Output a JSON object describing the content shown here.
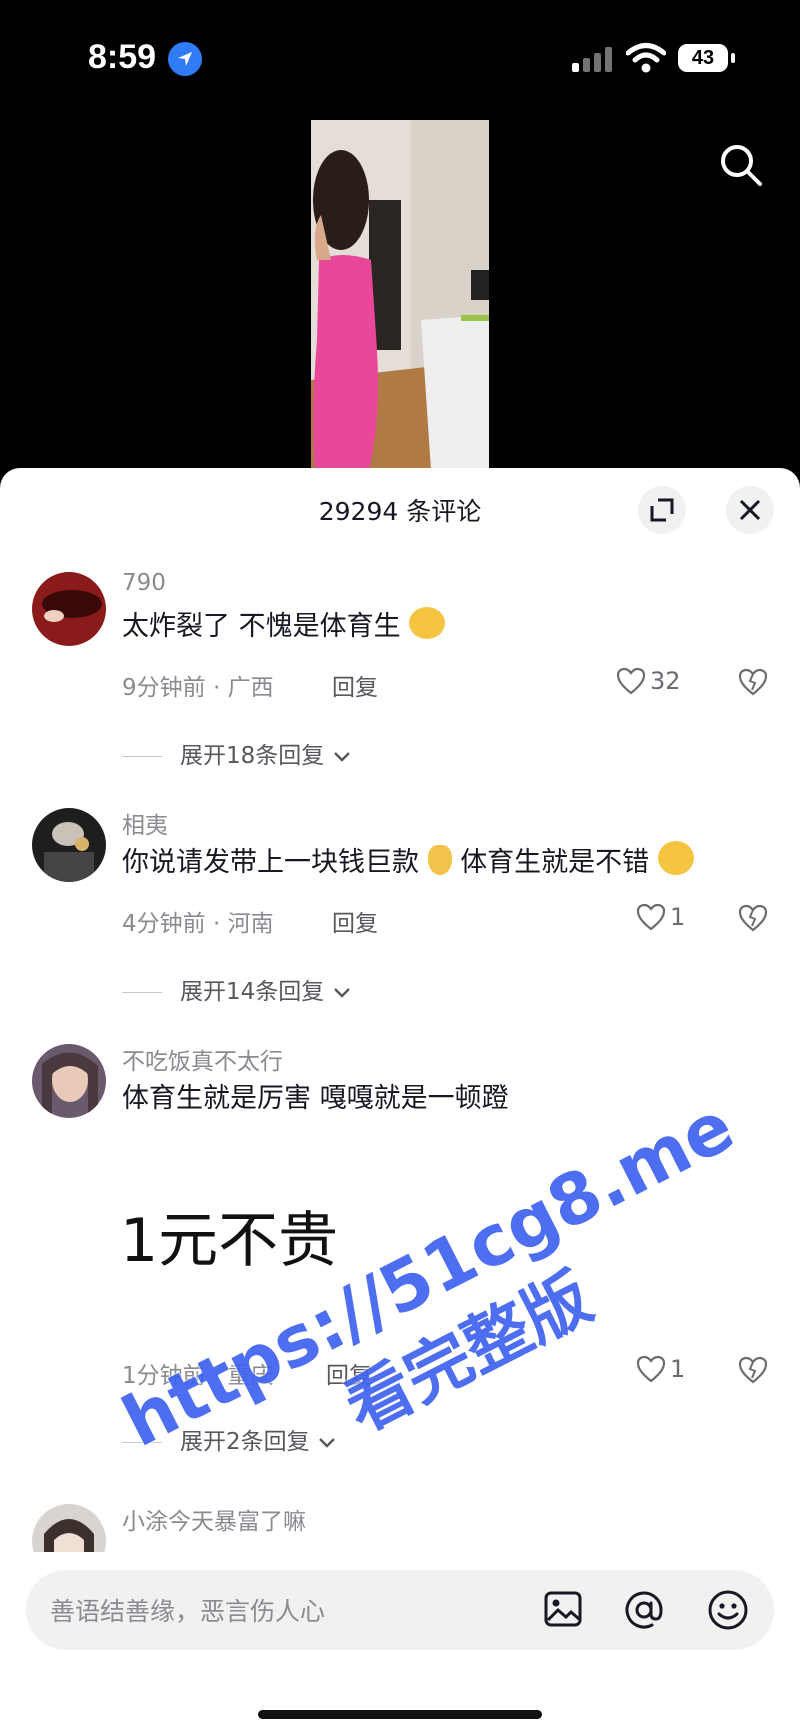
{
  "status_bar": {
    "time": "8:59",
    "battery": "43"
  },
  "comments_panel": {
    "title": "29294 条评论",
    "comments": [
      {
        "username": "790",
        "text": "太炸裂了 不愧是体育生",
        "time_location": "9分钟前 · 广西",
        "reply_label": "回复",
        "likes": "32",
        "expand_label": "展开18条回复"
      },
      {
        "username": "相夷",
        "text_part1": "你说请发带上一块钱巨款",
        "text_part2": "体育生就是不错",
        "time_location": "4分钟前 · 河南",
        "reply_label": "回复",
        "likes": "1",
        "expand_label": "展开14条回复"
      },
      {
        "username": "不吃饭真不太行",
        "text": "体育生就是厉害 嘎嘎就是一顿蹬",
        "image_text": "1元不贵",
        "time_location": "1分钟前 · 重庆",
        "reply_label": "回复",
        "likes": "1",
        "expand_label": "展开2条回复"
      },
      {
        "username": "小涂今天暴富了嘛"
      }
    ]
  },
  "input": {
    "placeholder": "善语结善缘，恶言伤人心"
  },
  "watermark": {
    "line1": "https://51cg8.me",
    "line2": "看完整版"
  },
  "colors": {
    "accent_watermark": "#3f62f0",
    "dress": "#e8479a",
    "muted_text": "#8a8b91"
  }
}
